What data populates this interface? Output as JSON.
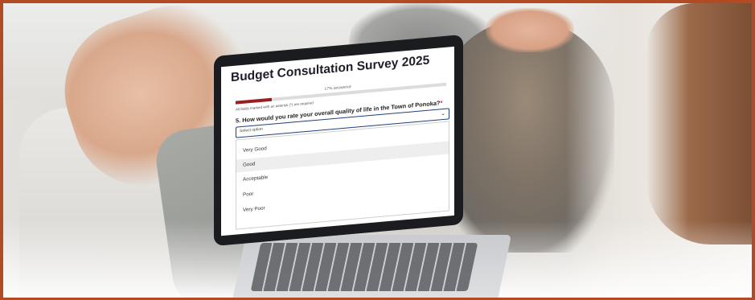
{
  "survey": {
    "title": "Budget Consultation Survey 2025",
    "progress_label": "17% answered",
    "progress_fraction": 0.17,
    "required_note": "All fields marked with an asterisk (*) are required",
    "question_text": "5.  How would you rate your overall quality of life in the Town of Ponoka?",
    "required_marker": "*",
    "select_placeholder": "Select option",
    "options": [
      "Very Good",
      "Good",
      "Acceptable",
      "Poor",
      "Very Poor"
    ],
    "highlighted_option": "Good"
  },
  "colors": {
    "frame": "#b24a24",
    "progress_fill": "#9b1f1f",
    "required_asterisk": "#c0242b",
    "select_border": "#1e3f7a"
  }
}
